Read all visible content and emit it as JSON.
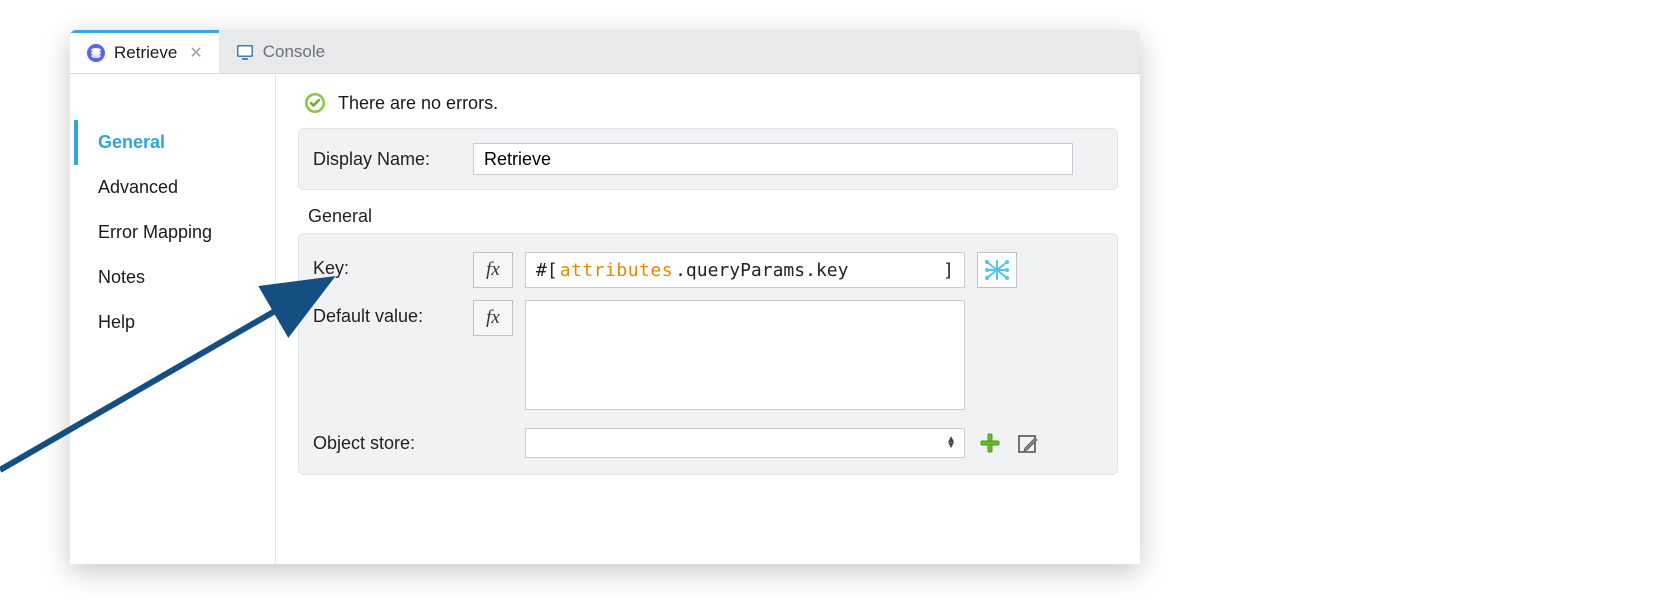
{
  "tabs": [
    {
      "label": "Retrieve",
      "icon": "stack-icon",
      "active": true,
      "closable": true
    },
    {
      "label": "Console",
      "icon": "console-icon",
      "active": false,
      "closable": false
    }
  ],
  "sidebar": {
    "items": [
      {
        "label": "General",
        "active": true
      },
      {
        "label": "Advanced",
        "active": false
      },
      {
        "label": "Error Mapping",
        "active": false
      },
      {
        "label": "Notes",
        "active": false
      },
      {
        "label": "Help",
        "active": false
      }
    ]
  },
  "status": {
    "message": "There are no errors."
  },
  "display": {
    "label": "Display Name:",
    "value": "Retrieve"
  },
  "section": {
    "title": "General"
  },
  "fields": {
    "key": {
      "label": "Key:",
      "expr_prefix": "#[",
      "expr_attr": "attributes",
      "expr_rest": ".queryParams.key",
      "expr_suffix": "]"
    },
    "default_value": {
      "label": "Default value:",
      "value": ""
    },
    "object_store": {
      "label": "Object store:",
      "selected": ""
    }
  },
  "buttons": {
    "fx": "fx"
  }
}
